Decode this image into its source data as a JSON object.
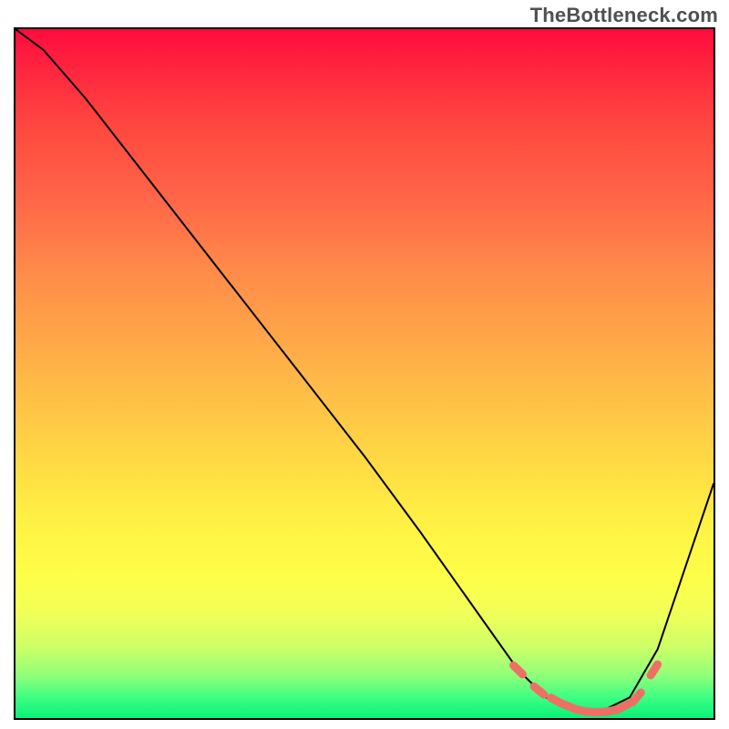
{
  "watermark": "TheBottleneck.com",
  "chart_data": {
    "type": "line",
    "title": "",
    "xlabel": "",
    "ylabel": "",
    "xlim": [
      0,
      100
    ],
    "ylim": [
      0,
      100
    ],
    "grid": false,
    "series": [
      {
        "name": "main-curve",
        "color": "#000000",
        "x": [
          0,
          4,
          10,
          20,
          30,
          40,
          50,
          58,
          65,
          72,
          76,
          80,
          84,
          88,
          92,
          100
        ],
        "y": [
          100,
          97,
          90,
          77,
          64,
          51,
          38,
          27,
          17,
          7,
          3,
          1,
          1,
          3,
          10,
          34
        ]
      },
      {
        "name": "trough-markers",
        "color": "#ee7064",
        "x": [
          72,
          75,
          77.5,
          79.5,
          81,
          82.5,
          84,
          85.5,
          87,
          89,
          91.5
        ],
        "y": [
          7,
          4,
          2.5,
          1.6,
          1.1,
          0.9,
          0.9,
          1.1,
          1.6,
          3,
          7
        ]
      }
    ]
  }
}
